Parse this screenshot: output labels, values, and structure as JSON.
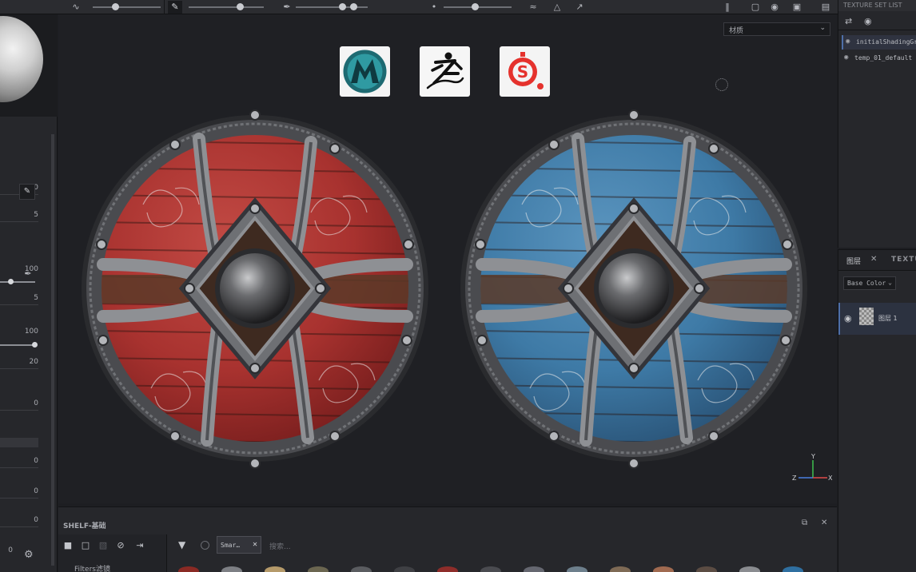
{
  "left_panel": {
    "values": [
      "10",
      "5",
      "100",
      "5",
      "100",
      "20",
      "0",
      "0",
      "0",
      "0",
      "0"
    ]
  },
  "viewport": {
    "material_select": "材质",
    "logos": [
      "maya-logo",
      "zbrush-logo",
      "substance-painter-logo"
    ],
    "shields": [
      {
        "name": "red-shield",
        "paint": "#a8322f",
        "paint_dark": "#7a1f1e",
        "paint_light": "#c24a44"
      },
      {
        "name": "blue-shield",
        "paint": "#3e7aa6",
        "paint_dark": "#2a5478",
        "paint_light": "#5b95bf"
      }
    ]
  },
  "texture_set_list": {
    "header": "TEXTURE SET LIST",
    "items": [
      {
        "label": "initialShadingGroup",
        "selected": true
      },
      {
        "label": "temp_01_default",
        "selected": false
      }
    ]
  },
  "layers_panel": {
    "tab_layers": "图层",
    "tab_texture": "TEXTURE",
    "channel": "Base Color",
    "layer_name": "图层 1"
  },
  "shelf": {
    "title": "SHELF-基础",
    "filters_label": "Filters滤镜",
    "chip": "Smar…",
    "search_placeholder": "搜索...",
    "swatch_colors": [
      "#8a2a24",
      "#7d7f84",
      "#b59a6a",
      "#6b6650",
      "#5a5c60",
      "#3f4044",
      "#8e2d2a",
      "#4a4b50",
      "#656770",
      "#6d7f8c",
      "#7e6a55",
      "#a06a50",
      "#5b4c43",
      "#8a8c90",
      "#2f6fa0"
    ]
  }
}
